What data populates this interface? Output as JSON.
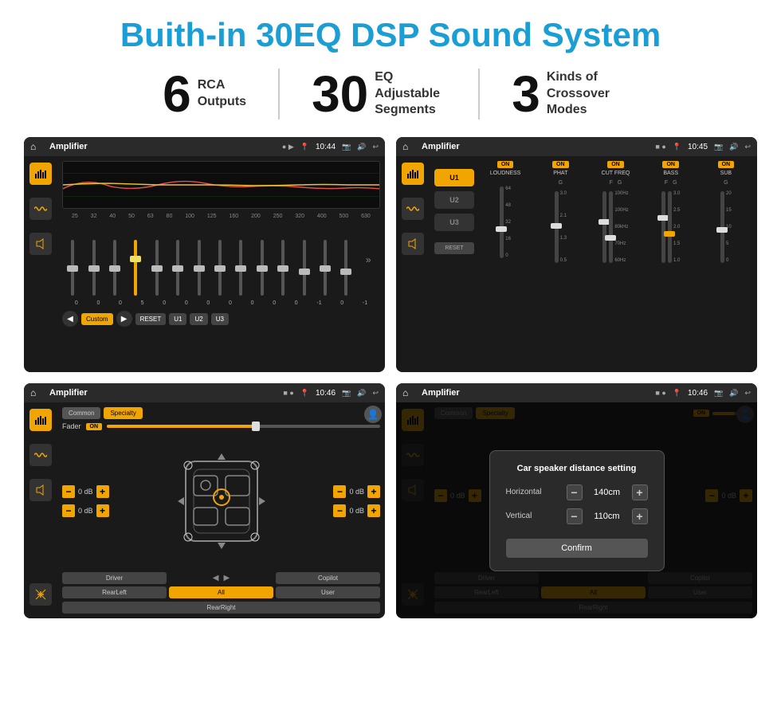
{
  "header": {
    "title": "Buith-in 30EQ DSP Sound System"
  },
  "stats": [
    {
      "number": "6",
      "label": "RCA\nOutputs"
    },
    {
      "number": "30",
      "label": "EQ Adjustable\nSegments"
    },
    {
      "number": "3",
      "label": "Kinds of\nCrossover Modes"
    }
  ],
  "screen1": {
    "statusBar": {
      "title": "Amplifier",
      "time": "10:44"
    },
    "eqBands": [
      "25",
      "32",
      "40",
      "50",
      "63",
      "80",
      "100",
      "125",
      "160",
      "200",
      "250",
      "320",
      "400",
      "500",
      "630"
    ],
    "eqValues": [
      "0",
      "0",
      "0",
      "5",
      "0",
      "0",
      "0",
      "0",
      "0",
      "0",
      "0",
      "-1",
      "0",
      "-1"
    ],
    "buttons": [
      "Custom",
      "RESET",
      "U1",
      "U2",
      "U3"
    ]
  },
  "screen2": {
    "statusBar": {
      "title": "Amplifier",
      "time": "10:45"
    },
    "uButtons": [
      "U1",
      "U2",
      "U3"
    ],
    "columns": [
      "LOUDNESS",
      "PHAT",
      "CUT FREQ",
      "BASS",
      "SUB"
    ],
    "onBadges": [
      "ON",
      "ON",
      "ON",
      "ON",
      "ON"
    ]
  },
  "screen3": {
    "statusBar": {
      "title": "Amplifier",
      "time": "10:46"
    },
    "tabs": [
      "Common",
      "Specialty"
    ],
    "faderLabel": "Fader",
    "dbValues": [
      "0 dB",
      "0 dB",
      "0 dB",
      "0 dB"
    ],
    "buttons": [
      "Driver",
      "Copilot",
      "RearLeft",
      "All",
      "User",
      "RearRight"
    ]
  },
  "screen4": {
    "statusBar": {
      "title": "Amplifier",
      "time": "10:46"
    },
    "tabs": [
      "Common",
      "Specialty"
    ],
    "dialog": {
      "title": "Car speaker distance setting",
      "horizontal": {
        "label": "Horizontal",
        "value": "140cm"
      },
      "vertical": {
        "label": "Vertical",
        "value": "110cm"
      },
      "confirmLabel": "Confirm"
    },
    "dbValues": [
      "0 dB",
      "0 dB"
    ],
    "buttons": [
      "Driver",
      "Copilot",
      "RearLeft",
      "All",
      "User",
      "RearRight"
    ]
  }
}
